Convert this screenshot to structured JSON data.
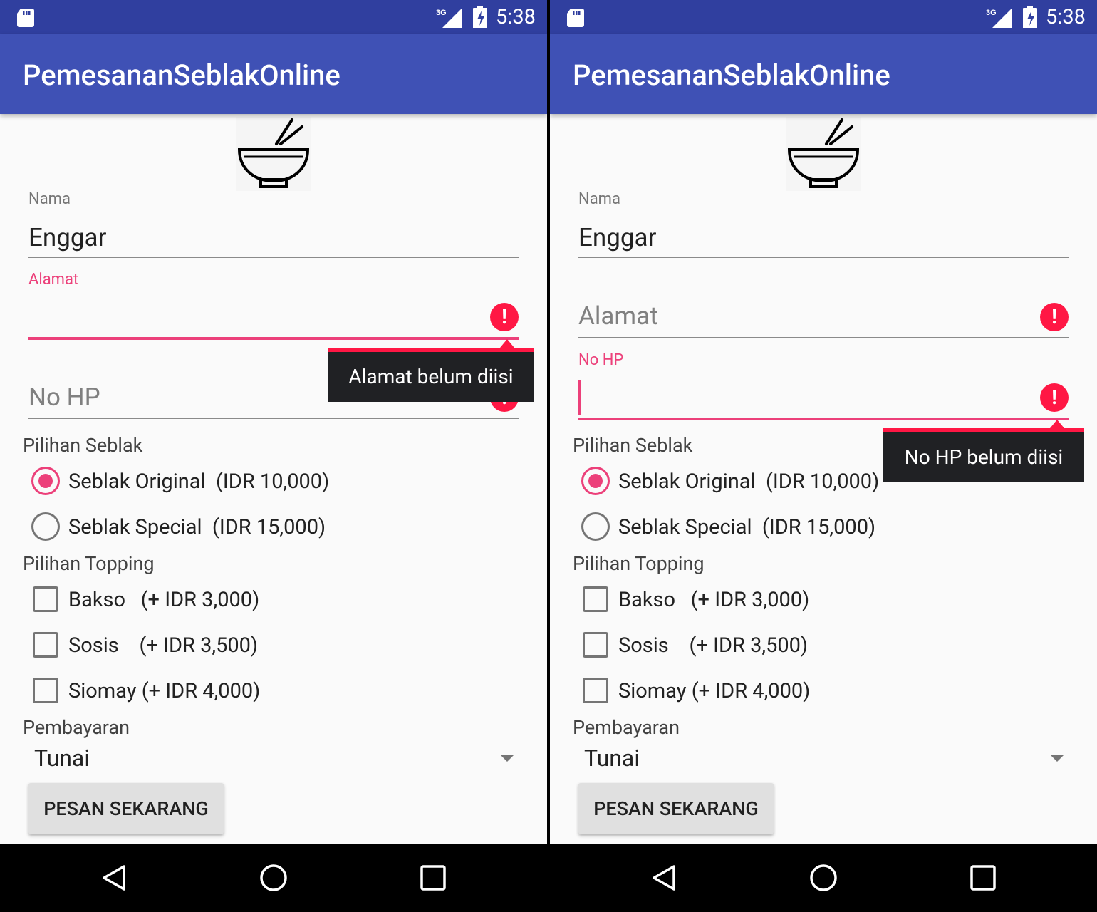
{
  "status_bar": {
    "time": "5:38",
    "network": "3G"
  },
  "app_bar": {
    "title": "PemesananSeblakOnline"
  },
  "form": {
    "nama_label": "Nama",
    "nama_value": "Enggar",
    "alamat_label": "Alamat",
    "alamat_hint": "Alamat",
    "nohp_label": "No HP",
    "nohp_hint": "No HP",
    "error_glyph": "!",
    "pilihan_seblak_label": "Pilihan Seblak",
    "seblak_options": [
      {
        "label": "Seblak Original  (IDR 10,000)",
        "selected": true
      },
      {
        "label": "Seblak Special  (IDR 15,000)",
        "selected": false
      }
    ],
    "pilihan_topping_label": "Pilihan Topping",
    "topping_options": [
      {
        "label": "Bakso   (+ IDR 3,000)",
        "checked": false
      },
      {
        "label": "Sosis    (+ IDR 3,500)",
        "checked": false
      },
      {
        "label": "Siomay (+ IDR 4,000)",
        "checked": false
      }
    ],
    "pembayaran_label": "Pembayaran",
    "pembayaran_value": "Tunai",
    "submit_label": "PESAN SEKARANG"
  },
  "screens": {
    "left": {
      "error_tooltip": "Alamat belum diisi",
      "focused_field": "alamat"
    },
    "right": {
      "error_tooltip": "No HP belum diisi",
      "focused_field": "nohp"
    }
  },
  "colors": {
    "status_bar": "#303f9f",
    "app_bar": "#3f51b5",
    "accent": "#ec407a",
    "error": "#ff1744",
    "tooltip_bg": "#202124",
    "background": "#fafafa"
  },
  "icons": [
    "sd-card-icon",
    "signal-3g-icon",
    "battery-charging-icon",
    "bowl-chopsticks-icon",
    "error-icon",
    "back-icon",
    "home-icon",
    "recents-icon",
    "dropdown-arrow-icon"
  ]
}
